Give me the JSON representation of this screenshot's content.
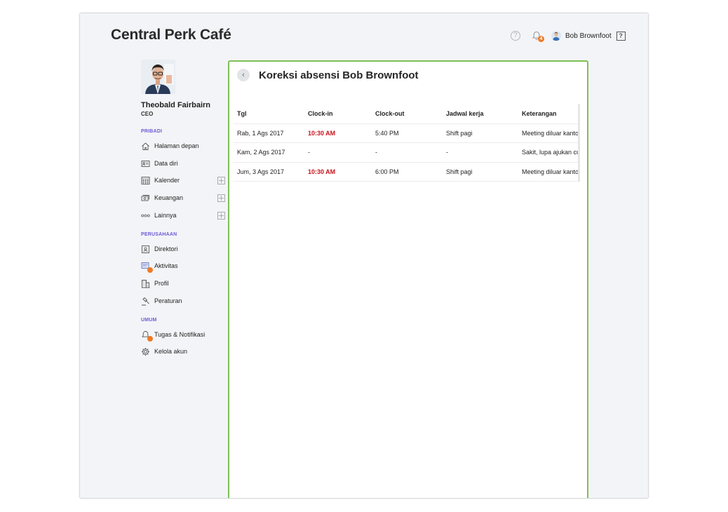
{
  "app": {
    "title": "Central Perk Café"
  },
  "topbar": {
    "help_icon": "help-circle-icon",
    "notification_icon": "bell-icon",
    "notification_count": "4",
    "user_name": "Bob Brownfoot",
    "help_box_label": "?"
  },
  "profile": {
    "name": "Theobald Fairbairn",
    "role": "CEO"
  },
  "sidebar": {
    "sections": [
      {
        "label": "PRIBADI"
      },
      {
        "label": "PERUSAHAAN"
      },
      {
        "label": "UMUM"
      }
    ],
    "items": [
      {
        "label": "Halaman depan",
        "icon": "home-icon"
      },
      {
        "label": "Data diri",
        "icon": "id-card-icon"
      },
      {
        "label": "Kalender",
        "icon": "calendar-icon"
      },
      {
        "label": "Keuangan",
        "icon": "money-icon"
      },
      {
        "label": "Lainnya",
        "icon": "more-icon"
      },
      {
        "label": "Direktori",
        "icon": "directory-icon"
      },
      {
        "label": "Aktivitas",
        "icon": "activity-icon"
      },
      {
        "label": "Profil",
        "icon": "building-icon"
      },
      {
        "label": "Peraturan",
        "icon": "gavel-icon"
      },
      {
        "label": "Tugas & Notifikasi",
        "icon": "bell-icon"
      },
      {
        "label": "Kelola akun",
        "icon": "gear-icon"
      }
    ]
  },
  "panel": {
    "title": "Koreksi absensi Bob Brownfoot",
    "back_label": "‹",
    "table": {
      "headers": [
        "Tgl",
        "Clock-in",
        "Clock-out",
        "Jadwal kerja",
        "Keterangan"
      ],
      "rows": [
        [
          "Rab, 1 Ags 2017",
          "10:30 AM",
          "5:40 PM",
          "Shift pagi",
          "Meeting diluar kantor"
        ],
        [
          "Kam, 2 Ags 2017",
          "-",
          "-",
          "-",
          "Sakit, lupa ajukan cuti"
        ],
        [
          "Jum, 3 Ags 2017",
          "10:30 AM",
          "6:00 PM",
          "Shift pagi",
          "Meeting diluar kantor"
        ]
      ]
    }
  },
  "colors": {
    "accent_green": "#7fbf57",
    "late_red": "#c8121a",
    "section_purple": "#6b5bd8",
    "badge_orange": "#ee7a26"
  }
}
